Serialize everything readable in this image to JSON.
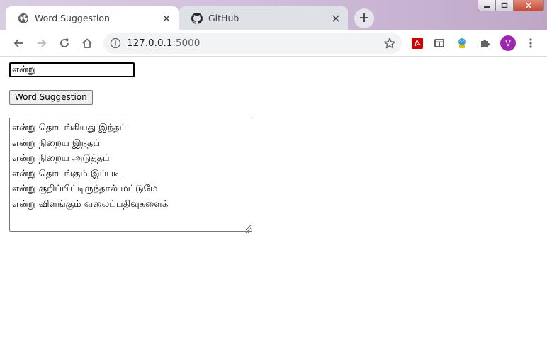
{
  "browser": {
    "tabs": [
      {
        "title": "Word Suggestion",
        "favicon": "globe-icon",
        "active": true
      },
      {
        "title": "GitHub",
        "favicon": "github-icon",
        "active": false
      }
    ],
    "address": {
      "host": "127.0.0.1",
      "port": ":5000"
    },
    "profile_initial": "V",
    "colors": {
      "tabstrip": "#d3c3de",
      "avatar": "#9c27b0",
      "pdf_ext": "#cc0000"
    }
  },
  "page": {
    "input_value": "என்று",
    "button_label": "Word Suggestion",
    "suggestions": "என்று தொடங்கியது இந்தப்\nஎன்று நிறைய இந்தப்\nஎன்று நிறைய அடுத்தப்\nஎன்று தொடங்கும் இப்படி\nஎன்று குறிப்பிட்டிருந்தால் மட்டுமே\nஎன்று விளங்கும் வலைப்பதிவுகளைக்"
  }
}
